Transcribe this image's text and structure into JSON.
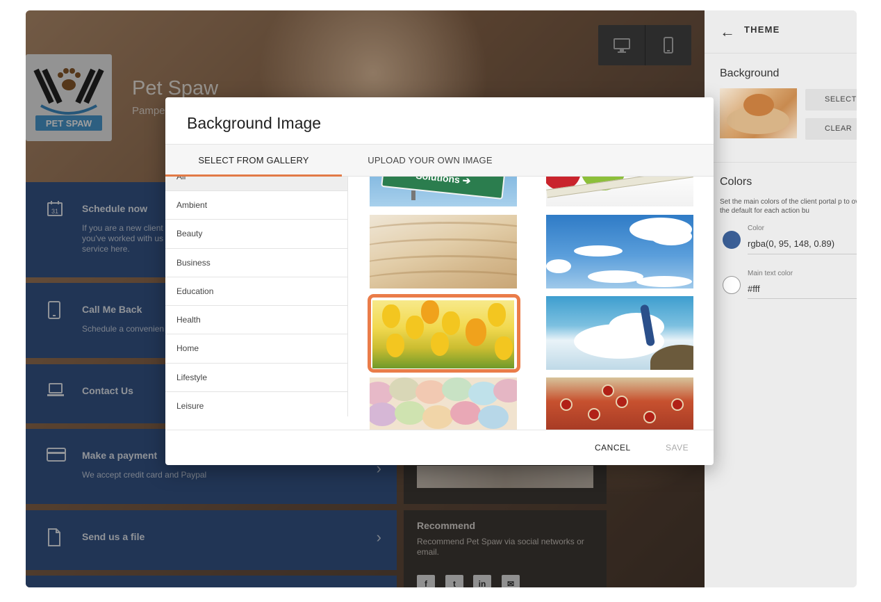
{
  "preview": {
    "brand_name": "Pet Spaw",
    "brand_tagline": "Pampe",
    "logo_text": "PET SPAW",
    "cards": [
      {
        "title": "Schedule now",
        "text": "If you are a new client\nyou've worked with us\nservice here.",
        "icon": "calendar-icon"
      },
      {
        "title": "Call Me Back",
        "text": "Schedule a convenien",
        "icon": "tablet-icon"
      },
      {
        "title": "Contact Us",
        "text": "",
        "icon": "laptop-icon"
      },
      {
        "title": "Make a payment",
        "text": "We accept credit card and Paypal",
        "icon": "credit-card-icon"
      },
      {
        "title": "Send us a file",
        "text": "",
        "icon": "file-icon"
      }
    ],
    "recommend": {
      "title": "Recommend",
      "text": "Recommend Pet Spaw via social networks or email."
    },
    "social": [
      "f",
      "t",
      "in",
      "✉"
    ]
  },
  "theme_panel": {
    "title": "THEME",
    "background_label": "Background",
    "select_label": "SELECT",
    "clear_label": "CLEAR",
    "colors_label": "Colors",
    "colors_description": "Set the main colors of the client portal p to override the default for each action bu",
    "color_field_label": "Color",
    "color_field_value": "rgba(0, 95, 148, 0.89)",
    "text_color_field_label": "Main text color",
    "text_color_field_value": "#fff",
    "swatch_primary": "#3b5f96",
    "swatch_text": "#ffffff"
  },
  "modal": {
    "title": "Background Image",
    "tabs": [
      {
        "label": "SELECT FROM GALLERY",
        "active": true
      },
      {
        "label": "UPLOAD YOUR OWN IMAGE",
        "active": false
      }
    ],
    "categories": [
      "All",
      "Ambient",
      "Beauty",
      "Business",
      "Education",
      "Health",
      "Home",
      "Lifestyle",
      "Leisure"
    ],
    "selected_category": "All",
    "gallery_sign_text": "Solutions ➔",
    "selected_image": "tulips",
    "cancel_label": "CANCEL",
    "save_label": "SAVE",
    "accent_color": "#e27a46"
  }
}
